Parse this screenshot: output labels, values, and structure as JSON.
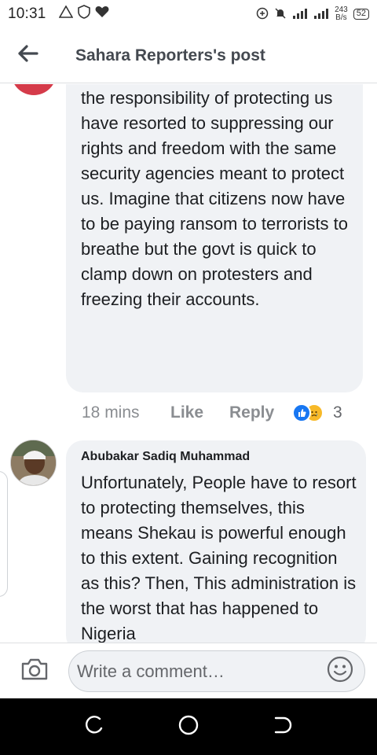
{
  "status_bar": {
    "time": "10:31",
    "net_speed_value": "243",
    "net_speed_unit": "B/s",
    "battery": "52",
    "icons": [
      "warning-icon",
      "shield-icon",
      "heart-icon",
      "data-saver-icon",
      "mute-icon",
      "signal-icon",
      "signal-icon",
      "wifi-icon"
    ]
  },
  "header": {
    "title": "Sahara Reporters's post",
    "back_icon": "arrow-left-icon"
  },
  "comments": [
    {
      "text": "It's so sad that those saddled with the responsibility of protecting us have resorted to suppressing our rights and freedom with the same security agencies meant to protect us. Imagine that citizens now have to be paying ransom to terrorists to breathe but the govt is quick to clamp down on protesters and freezing their accounts.",
      "time": "18 mins",
      "like_label": "Like",
      "reply_label": "Reply",
      "reaction_count": "3",
      "reactions": [
        "like",
        "sad"
      ]
    },
    {
      "author": "Abubakar Sadiq Muhammad",
      "text": "Unfortunately, People have to resort to protecting themselves, this means Shekau is powerful enough to this extent. Gaining recognition as this? Then, This administration is the worst that has happened to Nigeria"
    }
  ],
  "composer": {
    "placeholder": "Write a comment…",
    "camera_icon": "camera-icon",
    "emoji_icon": "emoji-icon"
  },
  "colors": {
    "bubble": "#f0f2f5",
    "meta_text": "#8a8d91",
    "like_blue": "#1877f2",
    "sad_yellow": "#f7b928"
  }
}
